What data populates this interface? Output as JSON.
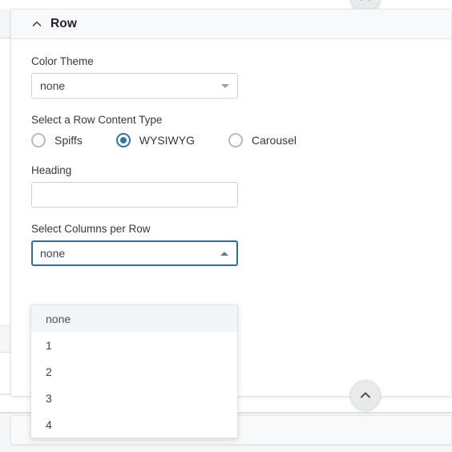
{
  "window": {
    "background_color": "#ffffff",
    "accent_color": "#2e6da4"
  },
  "scroll_top_button": {
    "icon": "chevron-up-icon"
  },
  "row_panel": {
    "header": {
      "title": "Row",
      "toggle_icon": "chevron-up-icon",
      "expanded": true
    },
    "fields": {
      "color_theme": {
        "label": "Color Theme",
        "value": "none",
        "arrow_icon": "chevron-down-icon",
        "open": false
      },
      "row_content_type": {
        "label": "Select a Row Content Type",
        "selected": "WYSIWYG",
        "options": [
          {
            "label": "Spiffs",
            "checked": false
          },
          {
            "label": "WYSIWYG",
            "checked": true
          },
          {
            "label": "Carousel",
            "checked": false
          }
        ]
      },
      "heading": {
        "label": "Heading",
        "value": "",
        "placeholder": ""
      },
      "columns_per_row": {
        "label": "Select Columns per Row",
        "value": "none",
        "arrow_icon": "chevron-up-icon",
        "open": true,
        "options": [
          {
            "label": "none",
            "highlighted": true
          },
          {
            "label": "1",
            "highlighted": false
          },
          {
            "label": "2",
            "highlighted": false
          },
          {
            "label": "3",
            "highlighted": false
          },
          {
            "label": "4",
            "highlighted": false
          }
        ]
      }
    }
  },
  "scroll_up_button": {
    "icon": "chevron-up-icon"
  },
  "next_panel": {
    "toggle_icon": "chevron-down-icon",
    "title": ""
  }
}
